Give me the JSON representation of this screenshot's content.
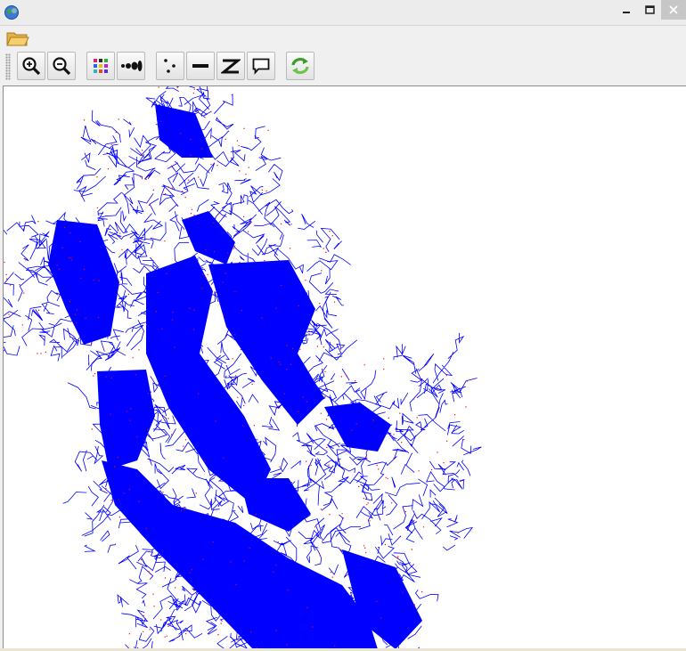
{
  "window": {
    "app_icon": "globe-icon",
    "controls": {
      "minimize": "minimize-icon",
      "maximize": "maximize-icon",
      "close": "close-icon"
    }
  },
  "menubar": {
    "open_icon": "folder-open-icon"
  },
  "toolbar": {
    "buttons": [
      {
        "name": "zoom-in-button",
        "icon": "zoom-in-icon"
      },
      {
        "name": "zoom-out-button",
        "icon": "zoom-out-icon"
      },
      {
        "name": "color-grid-button",
        "icon": "color-grid-icon"
      },
      {
        "name": "node-size-button",
        "icon": "node-size-icon"
      },
      {
        "name": "points-button",
        "icon": "points-icon"
      },
      {
        "name": "line-button",
        "icon": "line-icon"
      },
      {
        "name": "polyline-button",
        "icon": "polyline-icon"
      },
      {
        "name": "callout-button",
        "icon": "callout-icon"
      },
      {
        "name": "refresh-button",
        "icon": "refresh-icon"
      }
    ]
  },
  "map": {
    "edge_color": "#0000ff",
    "node_color": "#ff0000",
    "background": "#ffffff"
  }
}
